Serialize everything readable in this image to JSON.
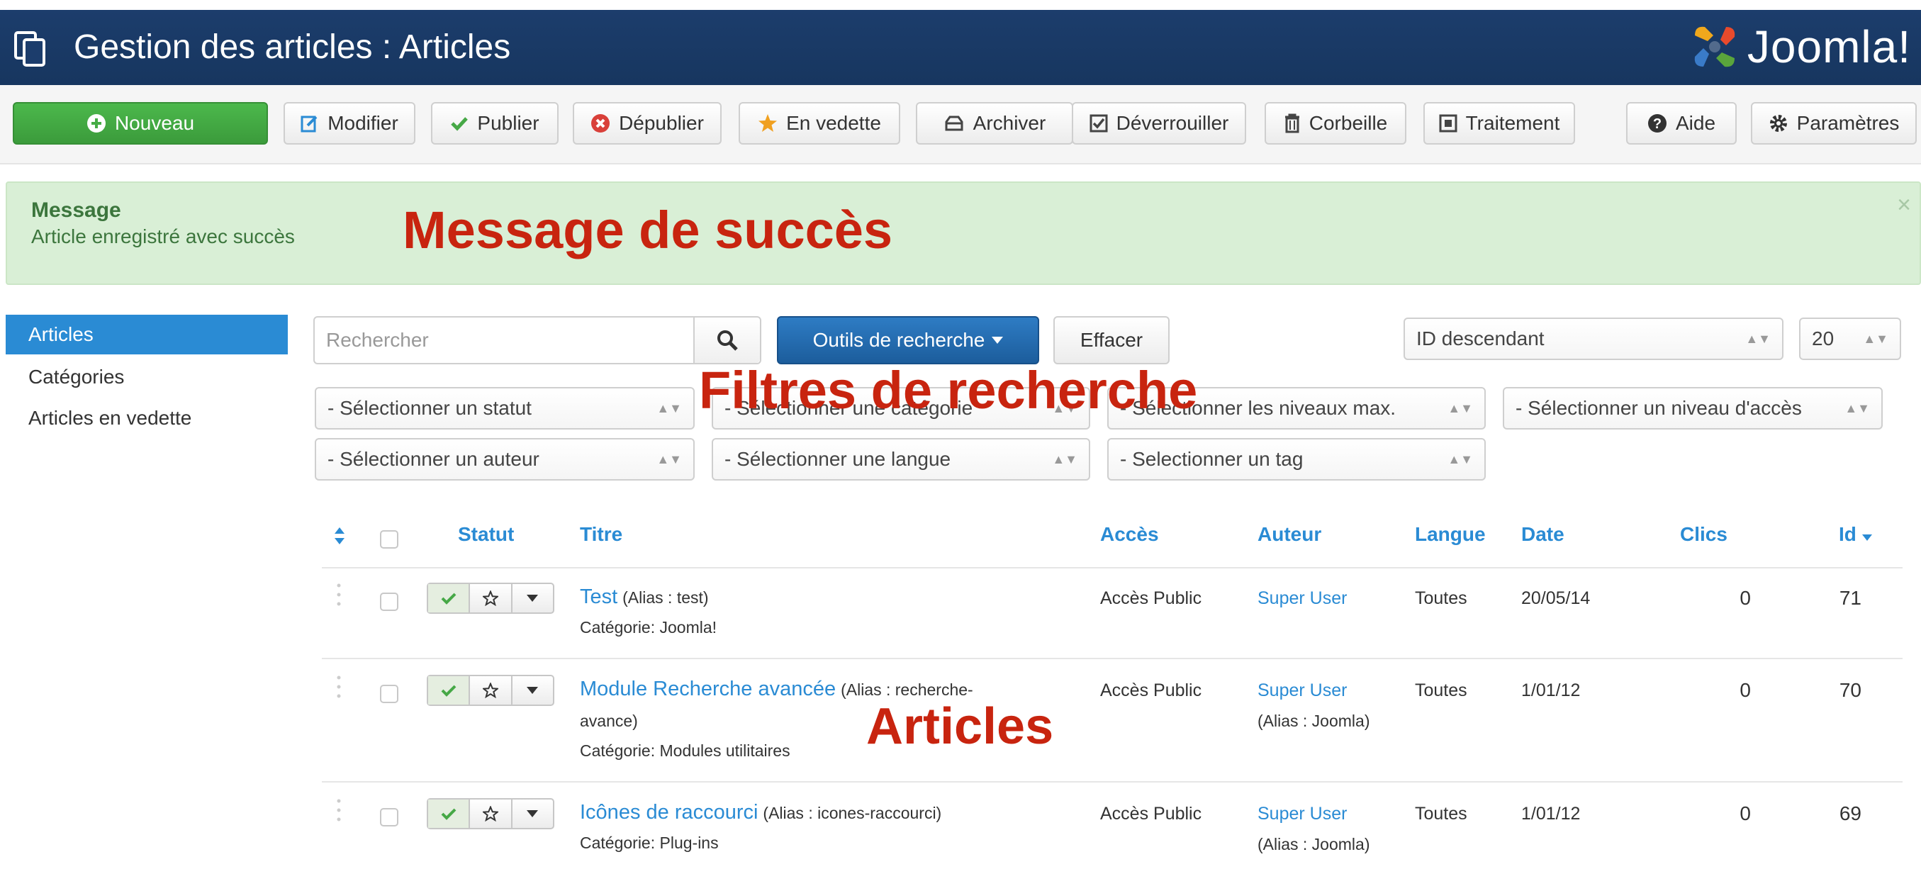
{
  "header": {
    "title": "Gestion des articles : Articles",
    "logo_text": "Joomla!"
  },
  "toolbar": {
    "new": "Nouveau",
    "edit": "Modifier",
    "publish": "Publier",
    "unpublish": "Dépublier",
    "featured": "En vedette",
    "archive": "Archiver",
    "checkin": "Déverrouiller",
    "trash": "Corbeille",
    "batch": "Traitement",
    "help": "Aide",
    "options": "Paramètres"
  },
  "message": {
    "heading": "Message",
    "text": "Article enregistré avec succès",
    "close": "×"
  },
  "annotations": {
    "message": "Message de succès",
    "filters": "Filtres de recherche",
    "articles": "Articles"
  },
  "sidebar": {
    "items": [
      "Articles",
      "Catégories",
      "Articles en vedette"
    ]
  },
  "search": {
    "placeholder": "Rechercher",
    "tools_label": "Outils de recherche",
    "clear_label": "Effacer",
    "ordering": "ID descendant",
    "limit": "20"
  },
  "filters": {
    "status": "- Sélectionner un statut",
    "category": "- Sélectionner une catégorie",
    "level": "- Sélectionner les niveaux max.",
    "access": "- Sélectionner un niveau d'accès",
    "author": "- Sélectionner un auteur",
    "language": "- Sélectionner une langue",
    "tag": "- Selectionner un tag"
  },
  "table": {
    "headers": {
      "status": "Statut",
      "title": "Titre",
      "access": "Accès",
      "author": "Auteur",
      "language": "Langue",
      "date": "Date",
      "hits": "Clics",
      "id": "Id"
    },
    "rows": [
      {
        "title": "Test",
        "alias": "(Alias : test)",
        "alias_cont": "",
        "category": "Catégorie: Joomla!",
        "access": "Accès Public",
        "author": "Super User",
        "author_alias": "",
        "language": "Toutes",
        "date": "20/05/14",
        "hits": "0",
        "id": "71"
      },
      {
        "title": "Module Recherche avancée",
        "alias": "(Alias : recherche-",
        "alias_cont": "avance)",
        "category": "Catégorie: Modules utilitaires",
        "access": "Accès Public",
        "author": "Super User",
        "author_alias": "(Alias : Joomla)",
        "language": "Toutes",
        "date": "1/01/12",
        "hits": "0",
        "id": "70"
      },
      {
        "title": "Icônes de raccourci",
        "alias": "(Alias : icones-raccourci)",
        "alias_cont": "",
        "category": "Catégorie: Plug-ins",
        "access": "Accès Public",
        "author": "Super User",
        "author_alias": "(Alias : Joomla)",
        "language": "Toutes",
        "date": "1/01/12",
        "hits": "0",
        "id": "69"
      }
    ]
  },
  "colors": {
    "header_bg": "#1c3d6c",
    "accent": "#2a8bd4",
    "success_bg": "#d9efd6",
    "annotation": "#c8240f",
    "green_button": "#46ac46"
  }
}
